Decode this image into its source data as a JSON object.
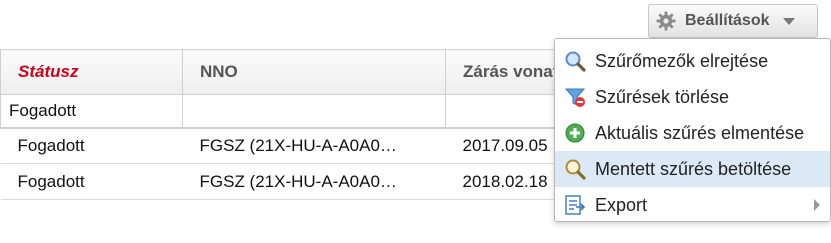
{
  "settings": {
    "label": "Beállítások",
    "icon": "gear-icon"
  },
  "table": {
    "columns": [
      "Státusz",
      "NNO",
      "Zárás vonatkozásában"
    ],
    "sorted_column_color": "#d0021b",
    "filters": [
      "Fogadott",
      "",
      ""
    ],
    "rows": [
      [
        "Fogadott",
        "FGSZ (21X-HU-A-A0A0…",
        "2017.09.05"
      ],
      [
        "Fogadott",
        "FGSZ (21X-HU-A-A0A0…",
        "2018.02.18"
      ]
    ]
  },
  "menu": {
    "items": [
      {
        "label": "Szűrőmezők elrejtése",
        "icon": "magnifier-icon"
      },
      {
        "label": "Szűrések törlése",
        "icon": "funnel-remove-icon"
      },
      {
        "label": "Aktuális szűrés elmentése",
        "icon": "plus-circle-icon"
      },
      {
        "label": "Mentett szűrés betöltése",
        "icon": "search-icon"
      },
      {
        "label": "Export",
        "icon": "export-icon"
      }
    ],
    "highlight_color": "#dbe8f5"
  }
}
